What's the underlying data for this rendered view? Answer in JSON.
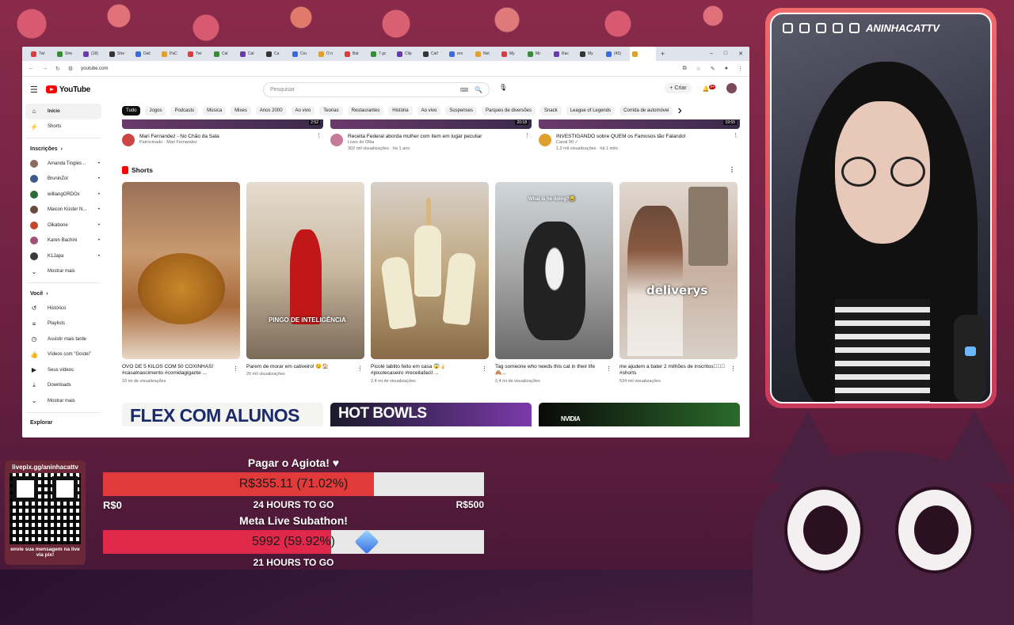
{
  "browser": {
    "tabs": [
      "Twi",
      "Stre",
      "(18)",
      "Stre",
      "Dail",
      "PaC",
      "Twi",
      "Cal",
      "Cal",
      "Ca",
      "Cru",
      "O n",
      "Bat",
      "7 gc",
      "Clip",
      "Cat!",
      "ero",
      "Net",
      "My",
      "Mc",
      "Rac",
      "My",
      "(45)",
      ""
    ],
    "url": "youtube.com",
    "win_min": "–",
    "win_max": "□",
    "win_close": "✕"
  },
  "youtube": {
    "logo": "YouTube",
    "search_placeholder": "Pesquisar",
    "create_label": "Criar",
    "notif_count": "9+",
    "chips": [
      "Tudo",
      "Jogos",
      "Podcasts",
      "Música",
      "Mixes",
      "Anos 2000",
      "Ao vivo",
      "Teorias",
      "Restaurantes",
      "História",
      "Ao vivo",
      "Suspenses",
      "Parques de diversões",
      "Snack",
      "League of Legends",
      "Corrida de automóvei"
    ],
    "sidebar": {
      "home": "Início",
      "shorts": "Shorts",
      "subs_header": "Inscrições",
      "subs": [
        {
          "name": "Amanda Tingles ..",
          "color": "#8a6a5a"
        },
        {
          "name": "BruninZor",
          "color": "#3a5a8a"
        },
        {
          "name": "williangORDOx",
          "color": "#2a6a3a"
        },
        {
          "name": "Maicon Küster N...",
          "color": "#6a4a3a"
        },
        {
          "name": "Oikabone",
          "color": "#c04a2a"
        },
        {
          "name": "Karen Bachini",
          "color": "#a0507a"
        },
        {
          "name": "K1Japa",
          "color": "#3a3a3a"
        }
      ],
      "show_more": "Mostrar mais",
      "you_header": "Você",
      "you_items": [
        {
          "label": "Histórico",
          "icon": "history-icon",
          "glyph": "↺"
        },
        {
          "label": "Playlists",
          "icon": "playlists-icon",
          "glyph": "≡"
        },
        {
          "label": "Assistir mais tarde",
          "icon": "watch-later-icon",
          "glyph": "◷"
        },
        {
          "label": "Vídeos com \"Gostei\"",
          "icon": "like-icon",
          "glyph": "👍"
        },
        {
          "label": "Seus vídeos",
          "icon": "your-videos-icon",
          "glyph": "▶"
        },
        {
          "label": "Downloads",
          "icon": "download-icon",
          "glyph": "⤓"
        }
      ],
      "show_more_2": "Mostrar mais",
      "explore": "Explorar"
    },
    "videos": [
      {
        "title": "Mari Fernandez - No Chão da Sala",
        "line1": "Patrocinado · Mari Fernandez",
        "line2": "",
        "duration": "2:52"
      },
      {
        "title": "Receita Federal aborda mulher com item em lugar peculiar",
        "line1": "Lives do Olka",
        "line2": "302 mil visualizações · há 1 ano",
        "duration": "20:18"
      },
      {
        "title": "INVESTIGANDO sobre QUEM os Famosos tão Falando!",
        "line1": "Canal 90 ✓",
        "line2": "1,2 mil visualizações · há 1 mês",
        "duration": "19:55"
      }
    ],
    "shorts_header": "Shorts",
    "shorts": [
      {
        "title": "OVO DE 5 KILOS COM 50 COXINHAS! #casalnascimento #comidagigante ...",
        "views": "10 mi de visualizações",
        "overlay": ""
      },
      {
        "title": "Parem de morar em cativeiro! 😊🏠",
        "views": "20 mil visualizações",
        "overlay": "PINGO DE INTELIGÊNCIA"
      },
      {
        "title": "Picolé tablito feito em casa 😱🍦 #picolecaseiro #receitafacil ...",
        "views": "2,4 mi de visualizações",
        "overlay": ""
      },
      {
        "title": "Tag someone who needs this cat in their life 🙈...",
        "views": "2,4 mi de visualizações",
        "overlay": "What is he doing?😂"
      },
      {
        "title": "me ajudem a bater 2 milhões de inscritos🏻🏻🏻 #shorts",
        "views": "534 mil visualizações",
        "overlay": "deliverys"
      }
    ],
    "banners": [
      "FLEX COM ALUNOS",
      "HOT BOWLS",
      "NVIDIA"
    ]
  },
  "webcam": {
    "channel": "ANINHACATTV",
    "social_icons": [
      "tiktok-icon",
      "discord-icon",
      "instagram-icon",
      "twitch-icon",
      "youtube-icon"
    ]
  },
  "donation": {
    "qr_url": "livepix.gg/aninhacattv",
    "qr_note": "envie sua mensagem na live via pix!",
    "goal1": {
      "title": "Pagar o Agiota! ♥",
      "value": "R$355.11 (71.02%)",
      "fraction": 0.7102,
      "min": "R$0",
      "max": "R$500",
      "time": "24 HOURS TO GO",
      "color": "#e03a3a"
    },
    "goal2": {
      "title": "Meta Live Subathon!",
      "value": "5992 (59.92%)",
      "fraction": 0.5992,
      "time": "21 HOURS TO GO",
      "color": "#e0284a"
    }
  }
}
